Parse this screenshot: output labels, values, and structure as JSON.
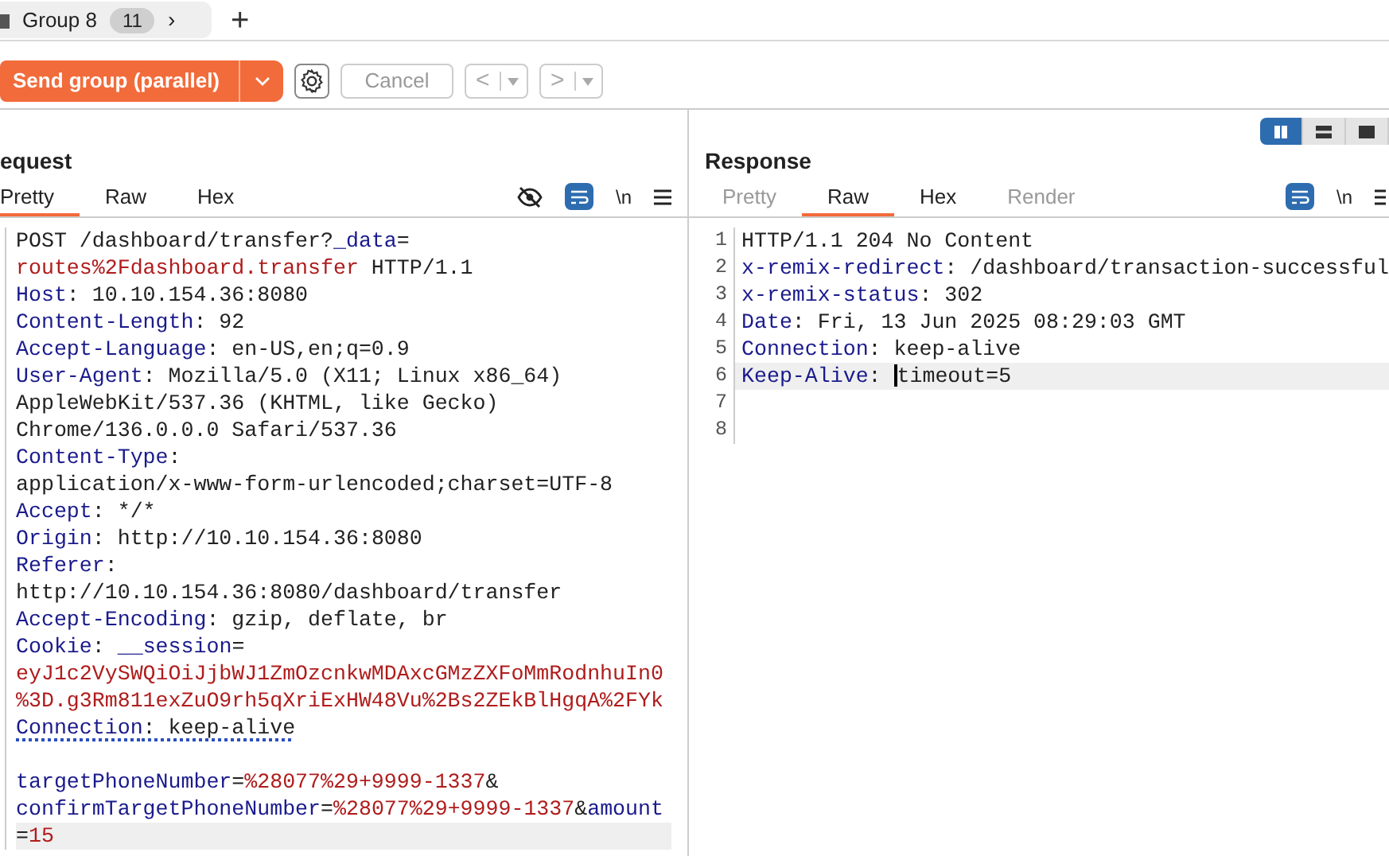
{
  "tab_bar": {
    "group": {
      "label": "Group 8",
      "count": "11",
      "chevron": "›"
    },
    "add": "+"
  },
  "toolbar": {
    "send": "Send group (parallel)",
    "cancel": "Cancel",
    "back": "<",
    "forward": ">"
  },
  "layout_toggles": [
    {
      "selected": true
    },
    {
      "selected": false
    },
    {
      "selected": false
    }
  ],
  "request": {
    "title": "equest",
    "tabs": [
      {
        "label": "Pretty",
        "selected": true,
        "disabled": false
      },
      {
        "label": "Raw",
        "selected": false,
        "disabled": false
      },
      {
        "label": "Hex",
        "selected": false,
        "disabled": false
      }
    ],
    "newline_toggle": "\\n",
    "lines": [
      {
        "segments": [
          {
            "kind": "plain",
            "text": "POST /dashboard/transfer?"
          },
          {
            "kind": "name",
            "text": "_data"
          },
          {
            "kind": "plain",
            "text": "="
          }
        ],
        "current": false,
        "underline": false
      },
      {
        "segments": [
          {
            "kind": "param",
            "text": "routes%2Fdashboard.transfer"
          },
          {
            "kind": "plain",
            "text": " HTTP/1.1"
          }
        ],
        "current": false,
        "underline": false
      },
      {
        "segments": [
          {
            "kind": "name",
            "text": "Host"
          },
          {
            "kind": "plain",
            "text": ": 10.10.154.36:8080"
          }
        ],
        "current": false,
        "underline": false
      },
      {
        "segments": [
          {
            "kind": "name",
            "text": "Content-Length"
          },
          {
            "kind": "plain",
            "text": ": 92"
          }
        ],
        "current": false,
        "underline": false
      },
      {
        "segments": [
          {
            "kind": "name",
            "text": "Accept-Language"
          },
          {
            "kind": "plain",
            "text": ": en-US,en;q=0.9"
          }
        ],
        "current": false,
        "underline": false
      },
      {
        "segments": [
          {
            "kind": "name",
            "text": "User-Agent"
          },
          {
            "kind": "plain",
            "text": ": Mozilla/5.0 (X11; Linux x86_64)"
          }
        ],
        "current": false,
        "underline": false
      },
      {
        "segments": [
          {
            "kind": "plain",
            "text": "AppleWebKit/537.36 (KHTML, like Gecko)"
          }
        ],
        "current": false,
        "underline": false
      },
      {
        "segments": [
          {
            "kind": "plain",
            "text": "Chrome/136.0.0.0 Safari/537.36"
          }
        ],
        "current": false,
        "underline": false
      },
      {
        "segments": [
          {
            "kind": "name",
            "text": "Content-Type"
          },
          {
            "kind": "plain",
            "text": ":"
          }
        ],
        "current": false,
        "underline": false
      },
      {
        "segments": [
          {
            "kind": "plain",
            "text": "application/x-www-form-urlencoded;charset=UTF-8"
          }
        ],
        "current": false,
        "underline": false
      },
      {
        "segments": [
          {
            "kind": "name",
            "text": "Accept"
          },
          {
            "kind": "plain",
            "text": ": */*"
          }
        ],
        "current": false,
        "underline": false
      },
      {
        "segments": [
          {
            "kind": "name",
            "text": "Origin"
          },
          {
            "kind": "plain",
            "text": ": http://10.10.154.36:8080"
          }
        ],
        "current": false,
        "underline": false
      },
      {
        "segments": [
          {
            "kind": "name",
            "text": "Referer"
          },
          {
            "kind": "plain",
            "text": ":"
          }
        ],
        "current": false,
        "underline": false
      },
      {
        "segments": [
          {
            "kind": "plain",
            "text": "http://10.10.154.36:8080/dashboard/transfer"
          }
        ],
        "current": false,
        "underline": false
      },
      {
        "segments": [
          {
            "kind": "name",
            "text": "Accept-Encoding"
          },
          {
            "kind": "plain",
            "text": ": gzip, deflate, br"
          }
        ],
        "current": false,
        "underline": false
      },
      {
        "segments": [
          {
            "kind": "name",
            "text": "Cookie"
          },
          {
            "kind": "plain",
            "text": ": "
          },
          {
            "kind": "name",
            "text": "__session"
          },
          {
            "kind": "plain",
            "text": "="
          }
        ],
        "current": false,
        "underline": false
      },
      {
        "segments": [
          {
            "kind": "param",
            "text": "eyJ1c2VySWQiOiJjbWJ1ZmOzcnkwMDAxcGMzZXFoMmRodnhuIn0"
          }
        ],
        "current": false,
        "underline": false
      },
      {
        "segments": [
          {
            "kind": "param",
            "text": "%3D.g3Rm811exZuO9rh5qXriExHW48Vu%2Bs2ZEkBlHgqA%2FYk"
          }
        ],
        "current": false,
        "underline": false
      },
      {
        "segments": [
          {
            "kind": "name",
            "text": "Connection"
          },
          {
            "kind": "plain",
            "text": ": keep-alive"
          }
        ],
        "current": false,
        "underline": true
      },
      {
        "current": false
      },
      {
        "segments": [
          {
            "kind": "name",
            "text": "targetPhoneNumber"
          },
          {
            "kind": "plain",
            "text": "="
          },
          {
            "kind": "param",
            "text": "%28077%29+9999-1337"
          },
          {
            "kind": "plain",
            "text": "&"
          }
        ],
        "current": false,
        "underline": false
      },
      {
        "segments": [
          {
            "kind": "name",
            "text": "confirmTargetPhoneNumber"
          },
          {
            "kind": "plain",
            "text": "="
          },
          {
            "kind": "param",
            "text": "%28077%29+9999-1337"
          },
          {
            "kind": "plain",
            "text": "&"
          },
          {
            "kind": "name",
            "text": "amount"
          }
        ],
        "current": false,
        "underline": false
      },
      {
        "segments": [
          {
            "kind": "plain",
            "text": "="
          },
          {
            "kind": "param",
            "text": "15"
          }
        ],
        "current": true,
        "underline": false
      }
    ]
  },
  "response": {
    "title": "Response",
    "tabs": [
      {
        "label": "Pretty",
        "selected": false,
        "disabled": true
      },
      {
        "label": "Raw",
        "selected": true,
        "disabled": false
      },
      {
        "label": "Hex",
        "selected": false,
        "disabled": false
      },
      {
        "label": "Render",
        "selected": false,
        "disabled": true
      }
    ],
    "newline_toggle": "\\n",
    "lines": [
      {
        "number": "1",
        "segments": [
          {
            "kind": "plain",
            "text": "HTTP/1.1 204 No Content"
          }
        ],
        "current": false
      },
      {
        "number": "2",
        "segments": [
          {
            "kind": "name",
            "text": "x-remix-redirect"
          },
          {
            "kind": "plain",
            "text": ": /dashboard/transaction-successful"
          }
        ],
        "current": false
      },
      {
        "number": "3",
        "segments": [
          {
            "kind": "name",
            "text": "x-remix-status"
          },
          {
            "kind": "plain",
            "text": ": 302"
          }
        ],
        "current": false
      },
      {
        "number": "4",
        "segments": [
          {
            "kind": "name",
            "text": "Date"
          },
          {
            "kind": "plain",
            "text": ": Fri, 13 Jun 2025 08:29:03 GMT"
          }
        ],
        "current": false
      },
      {
        "number": "5",
        "segments": [
          {
            "kind": "name",
            "text": "Connection"
          },
          {
            "kind": "plain",
            "text": ": keep-alive"
          }
        ],
        "current": false
      },
      {
        "number": "6",
        "segments": [
          {
            "kind": "name",
            "text": "Keep-Alive"
          },
          {
            "kind": "plain",
            "text": ": "
          },
          {
            "kind": "plain",
            "text": "timeout=5"
          }
        ],
        "current": true
      },
      {
        "number": "7",
        "current": false
      },
      {
        "number": "8",
        "current": false
      }
    ]
  }
}
